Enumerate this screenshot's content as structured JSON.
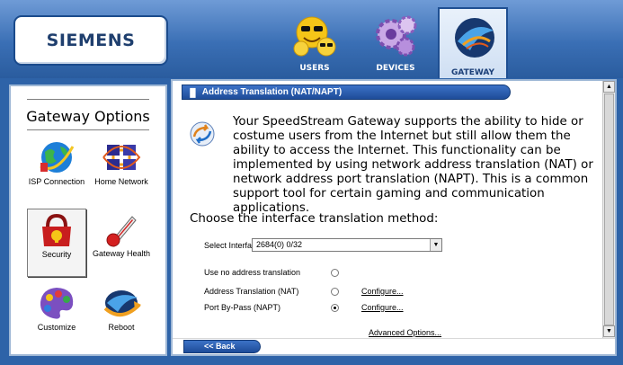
{
  "brand": {
    "logo": "SIEMENS"
  },
  "nav": {
    "tabs": [
      {
        "label": "USERS",
        "icon": "users-smiley-icon"
      },
      {
        "label": "DEVICES",
        "icon": "devices-gears-icon"
      },
      {
        "label": "GATEWAY",
        "icon": "gateway-globe-icon",
        "selected": true
      }
    ]
  },
  "sidebar": {
    "title": "Gateway Options",
    "items": [
      {
        "label": "ISP Connection",
        "icon": "isp-globe-icon"
      },
      {
        "label": "Home Network",
        "icon": "home-network-icon"
      },
      {
        "label": "Security",
        "icon": "security-lock-icon",
        "selected": true
      },
      {
        "label": "Gateway Health",
        "icon": "thermometer-icon"
      },
      {
        "label": "Customize",
        "icon": "palette-icon"
      },
      {
        "label": "Reboot",
        "icon": "reboot-icon"
      }
    ]
  },
  "main": {
    "section_title": "Address Translation (NAT/NAPT)",
    "intro": "Your SpeedStream Gateway supports the ability to hide or costume users from the Internet but still allow them the ability to access the Internet. This functionality can be implemented by using network address translation (NAT) or network address port translation (NAPT). This is a common support tool for certain gaming and communication applications.",
    "choose_prompt": "Choose the interface translation method:",
    "select_interface": {
      "label": "Select Interface:",
      "value": "2684(0) 0/32"
    },
    "options": [
      {
        "label": "Use no address translation",
        "checked": false,
        "configure": ""
      },
      {
        "label": "Address Translation (NAT)",
        "checked": false,
        "configure": "Configure..."
      },
      {
        "label": "Port By-Pass (NAPT)",
        "checked": true,
        "configure": "Configure..."
      }
    ],
    "advanced_link": "Advanced Options...",
    "back_button": "<< Back"
  },
  "colors": {
    "accent": "#2e63a8",
    "bar": "#1e4c99"
  }
}
